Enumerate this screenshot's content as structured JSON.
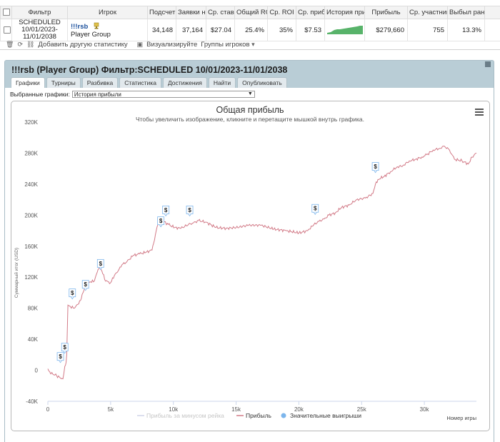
{
  "table": {
    "headers": [
      "Фильтр",
      "Игрок",
      "Подсчет",
      "Заявки н",
      "Ср. ставк",
      "Общий ROI",
      "Ср. ROI",
      "Ср. прибы",
      "История прибы",
      "Прибыль",
      "Ср. участник",
      "Выбыл рано"
    ],
    "row": {
      "filter": "SCHEDULED 10/01/2023-11/01/2038",
      "player_name": "!!!rsb",
      "player_group": "Player Group",
      "count": "34,148",
      "entries": "37,164",
      "avg_stake": "$27.04",
      "total_roi": "25.4%",
      "avg_roi": "35%",
      "avg_profit": "$7.53",
      "profit": "$279,660",
      "avg_field": "755",
      "early_out": "13.3%"
    }
  },
  "toolbar": {
    "add_stat": "Добавить другую статистику",
    "visualize": "Визуализируйте",
    "player_groups": "Группы игроков"
  },
  "panel": {
    "title": "!!!rsb (Player Group) Фильтр:SCHEDULED 10/01/2023-11/01/2038",
    "tabs": [
      "Графики",
      "Турниры",
      "Разбивка",
      "Статистика",
      "Достижения",
      "Найти",
      "Опубликовать"
    ],
    "selector_label": "Выбранные графики:",
    "selector_value": "История прибыли"
  },
  "chart_data": {
    "type": "line",
    "title": "Общая прибыль",
    "subtitle": "Чтобы увеличить изображение, кликните и перетащите мышкой внутрь графика.",
    "xlabel": "Номер игры",
    "ylabel": "Суммарный итог (USD)",
    "xlim": [
      0,
      34148
    ],
    "ylim": [
      -40000,
      320000
    ],
    "x_ticks": [
      "0",
      "5k",
      "10k",
      "15k",
      "20k",
      "25k",
      "30k"
    ],
    "y_ticks": [
      "-40K",
      "0",
      "40K",
      "80K",
      "120K",
      "160K",
      "200K",
      "240K",
      "280K",
      "320K"
    ],
    "grid": false,
    "legend": [
      "Прибыль за минусом рейка",
      "Прибыль",
      "Значительные выигрыши"
    ],
    "series": [
      {
        "name": "Прибыль",
        "x": [
          0,
          150,
          400,
          700,
          1000,
          1200,
          1350,
          1450,
          1500,
          1600,
          1800,
          2100,
          2400,
          2600,
          2800,
          3000,
          3200,
          3400,
          3700,
          3900,
          4000,
          4100,
          4300,
          4600,
          5000,
          5300,
          5600,
          5900,
          6300,
          6800,
          7300,
          7800,
          8300,
          8500,
          8700,
          8900,
          9200,
          9600,
          10100,
          10600,
          11200,
          11600,
          12000,
          12600,
          13400,
          14200,
          15000,
          16000,
          17000,
          18000,
          19000,
          20000,
          20700,
          21200,
          21600,
          22000,
          22400,
          22900,
          23400,
          24000,
          24600,
          25300,
          25900,
          26100,
          26300,
          26800,
          27300,
          27800,
          28300,
          28800,
          29300,
          29800,
          30200,
          30700,
          31200,
          31600,
          32000,
          32400,
          33000,
          33500,
          33800,
          34148
        ],
        "y": [
          2000,
          -2000,
          -5000,
          -7000,
          -10000,
          -11000,
          5000,
          10000,
          20000,
          84000,
          82000,
          80000,
          85000,
          90000,
          100000,
          108000,
          112000,
          114000,
          115000,
          125000,
          130000,
          132000,
          128000,
          115000,
          113000,
          122000,
          128000,
          136000,
          140000,
          148000,
          150000,
          152000,
          155000,
          168000,
          185000,
          190000,
          192000,
          188000,
          184000,
          183000,
          188000,
          190000,
          193000,
          191000,
          184000,
          183000,
          184000,
          187000,
          187000,
          182000,
          180000,
          177000,
          180000,
          188000,
          192000,
          195000,
          200000,
          203000,
          210000,
          213000,
          220000,
          222000,
          228000,
          240000,
          246000,
          250000,
          256000,
          262000,
          264000,
          270000,
          272000,
          275000,
          278000,
          284000,
          286000,
          289000,
          284000,
          272000,
          270000,
          266000,
          275000,
          280000
        ]
      }
    ],
    "big_wins_x": [
      1000,
      1350,
      1950,
      3000,
      4200,
      9000,
      9400,
      11300,
      21300,
      26100
    ],
    "big_wins_y": [
      10000,
      22000,
      92000,
      103000,
      130000,
      185000,
      199000,
      199000,
      201000,
      255000
    ],
    "big_win_label": "$",
    "colors": {
      "profit_line": "#d27a87",
      "rake_line": "#b9c0e4",
      "big_win": "#7cb5ec",
      "history_bar": "#58b36a"
    }
  }
}
